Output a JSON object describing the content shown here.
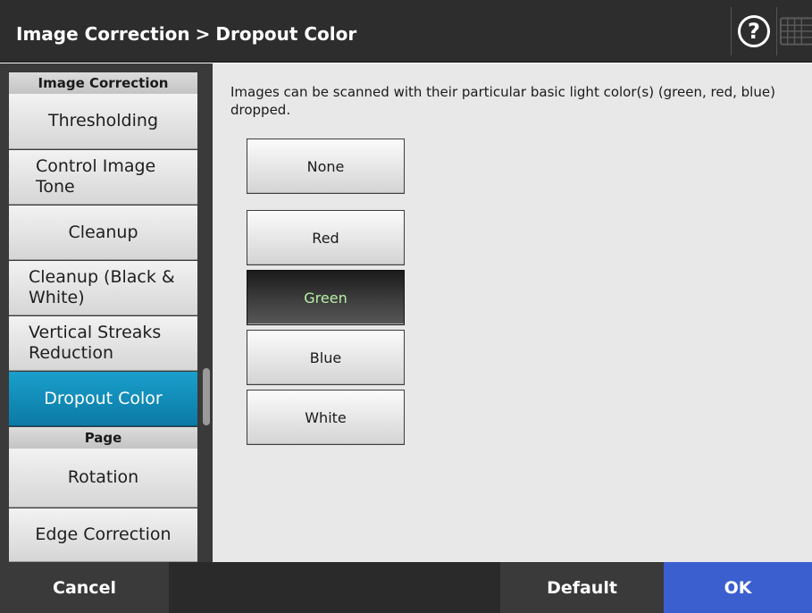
{
  "header": {
    "title_part1": "Image Correction",
    "separator": ">",
    "title_part2": "Dropout Color",
    "help_label": "?",
    "help_icon": "help-icon",
    "keyboard_icon": "keyboard-icon"
  },
  "sidebar": {
    "section1": "Image Correction",
    "items1": [
      "Thresholding",
      "Control Image Tone",
      "Cleanup",
      "Cleanup (Black & White)",
      "Vertical Streaks Reduction",
      "Dropout Color"
    ],
    "section2": "Page",
    "items2": [
      "Rotation",
      "Edge Correction"
    ],
    "selected": "Dropout Color"
  },
  "content": {
    "description": "Images can be scanned with their particular basic light color(s) (green, red, blue) dropped.",
    "options": [
      "None",
      "Red",
      "Green",
      "Blue",
      "White"
    ],
    "selected_option": "Green"
  },
  "footer": {
    "cancel": "Cancel",
    "default": "Default",
    "ok": "OK"
  },
  "colors": {
    "selected_sidebar": "#0b7aa5",
    "ok_button": "#3b5fcf",
    "selected_option_text": "#b8f0a8"
  }
}
